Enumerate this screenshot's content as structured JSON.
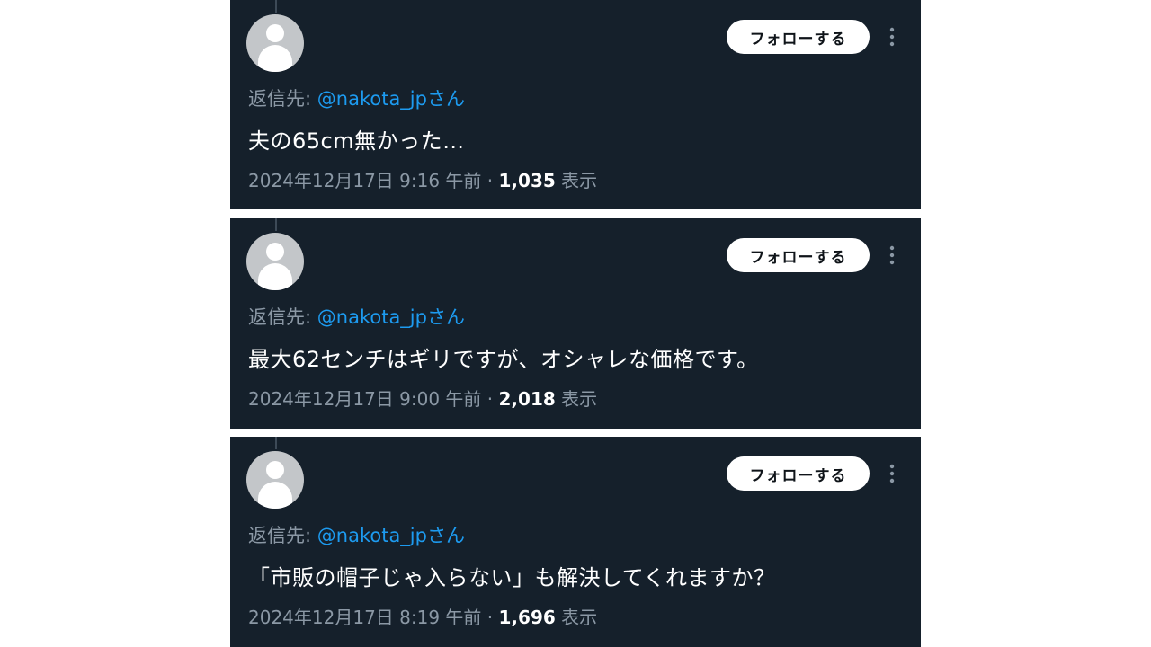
{
  "tweets": [
    {
      "follow_label": "フォローする",
      "reply_prefix": "返信先: ",
      "reply_handle": "@nakota_jpさん",
      "text": "夫の65cm無かった…",
      "timestamp": "2024年12月17日 9:16 午前",
      "separator": " · ",
      "views_count": "1,035",
      "views_label": " 表示"
    },
    {
      "follow_label": "フォローする",
      "reply_prefix": "返信先: ",
      "reply_handle": "@nakota_jpさん",
      "text": "最大62センチはギリですが、オシャレな価格です。",
      "timestamp": "2024年12月17日 9:00 午前",
      "separator": " · ",
      "views_count": "2,018",
      "views_label": " 表示"
    },
    {
      "follow_label": "フォローする",
      "reply_prefix": "返信先: ",
      "reply_handle": "@nakota_jpさん",
      "text": "「市販の帽子じゃ入らない」も解決してくれますか？",
      "timestamp": "2024年12月17日 8:19 午前",
      "separator": " · ",
      "views_count": "1,696",
      "views_label": " 表示"
    }
  ],
  "icons": {
    "avatar": "default-avatar-icon",
    "more": "more-vertical-icon"
  },
  "colors": {
    "card_background": "#15202b",
    "secondary_text": "#8b98a5",
    "link": "#1d9bf0",
    "primary_text": "#ffffff"
  }
}
